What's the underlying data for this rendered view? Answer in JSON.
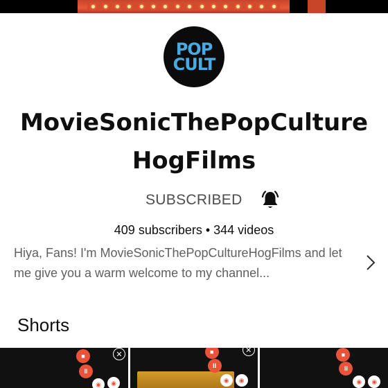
{
  "channel": {
    "name": "MovieSonicThePopCultureHogFilms",
    "logo_text_top": "POP",
    "logo_text_bottom": "CULT",
    "subscribe_label": "SUBSCRIBED",
    "stats": "409 subscribers • 344 videos",
    "description": "Hiya, Fans! I'm MovieSonicThePopCultureHogFilms and let me give you a warm welcome to my channel..."
  },
  "sections": {
    "shorts_title": "Shorts"
  },
  "shorts": [
    {
      "rec_label": "II",
      "has_close": true
    },
    {
      "rec_label": "II",
      "has_close": false
    },
    {
      "rec_label": "II",
      "has_close": false
    }
  ],
  "colors": {
    "accent": "#e8533a",
    "logo_blue": "#4aa9de",
    "text_primary": "#0f0f0f",
    "text_secondary": "#606060"
  },
  "icons": {
    "bell": "bell-icon",
    "chevron": "chevron-right-icon"
  }
}
